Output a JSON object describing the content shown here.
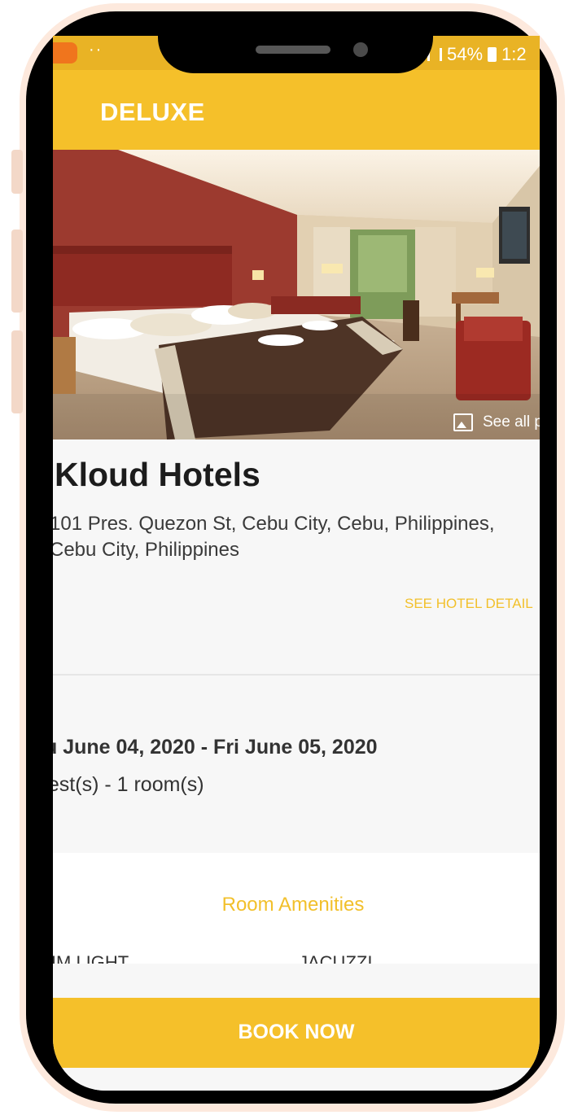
{
  "status_bar": {
    "dots": "··",
    "battery_percent": "54%",
    "time": "1:2"
  },
  "app_bar": {
    "title": "DELUXE"
  },
  "hero": {
    "see_all_label": "See all p"
  },
  "hotel": {
    "name": "Kloud Hotels",
    "address_line1": "101 Pres. Quezon St, Cebu City, Cebu, Philippines,",
    "address_line2": "Cebu City, Philippines",
    "see_details_label": "SEE HOTEL DETAIL"
  },
  "booking": {
    "dates": "u June 04, 2020 - Fri June 05, 2020",
    "guests": "uest(s) - 1 room(s)"
  },
  "amenities": {
    "title": "Room Amenities",
    "items": [
      "DIM LIGHT",
      "JACUZZI"
    ]
  },
  "book_button": {
    "label": "BOOK NOW"
  },
  "colors": {
    "accent": "#f5c02a",
    "status_bar": "#e9b325",
    "link": "#f2c02b"
  }
}
